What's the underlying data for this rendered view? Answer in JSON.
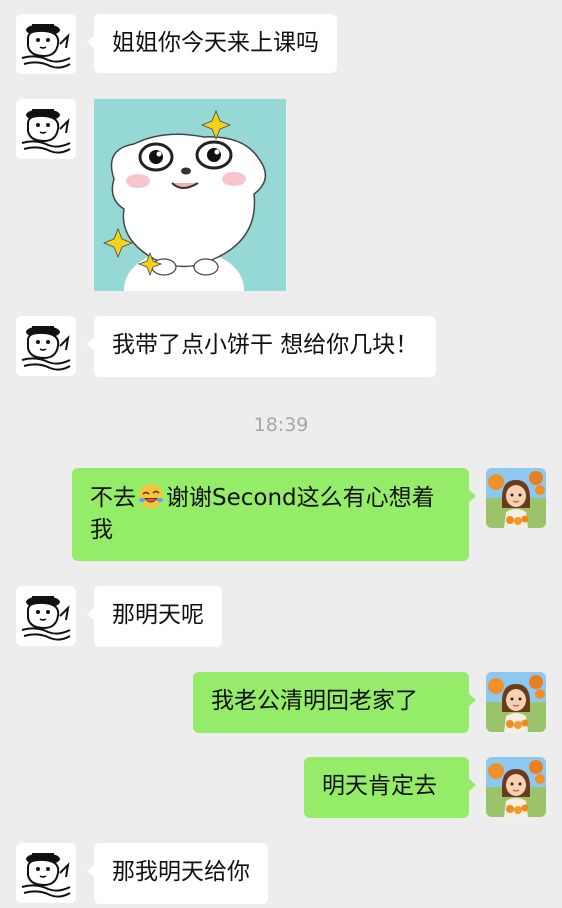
{
  "messages": [
    {
      "sender": "other",
      "text": "姐姐你今天来上课吗"
    },
    {
      "sender": "other",
      "type": "sticker",
      "sticker_icon": "puppy-sticker-icon"
    },
    {
      "sender": "other",
      "text": "我带了点小饼干 想给你几块！"
    },
    {
      "type": "timestamp",
      "text": "18:39"
    },
    {
      "sender": "me",
      "text_before": "不去",
      "emoji_icon": "rofl-emoji-icon",
      "text_after": "谢谢Second这么有心想着我"
    },
    {
      "sender": "other",
      "text": "那明天呢"
    },
    {
      "sender": "me",
      "text": "我老公清明回老家了"
    },
    {
      "sender": "me",
      "text": "明天肯定去"
    },
    {
      "sender": "other",
      "text": "那我明天给你"
    }
  ],
  "colors": {
    "background": "#ededed",
    "incoming_bubble": "#ffffff",
    "outgoing_bubble": "#95ec69",
    "timestamp_text": "#a7a7a7",
    "sticker_background": "#96d8d6"
  },
  "avatars": {
    "other_icon": "cartoon-dog-avatar-icon",
    "me_icon": "cartoon-girl-avatar-icon"
  }
}
